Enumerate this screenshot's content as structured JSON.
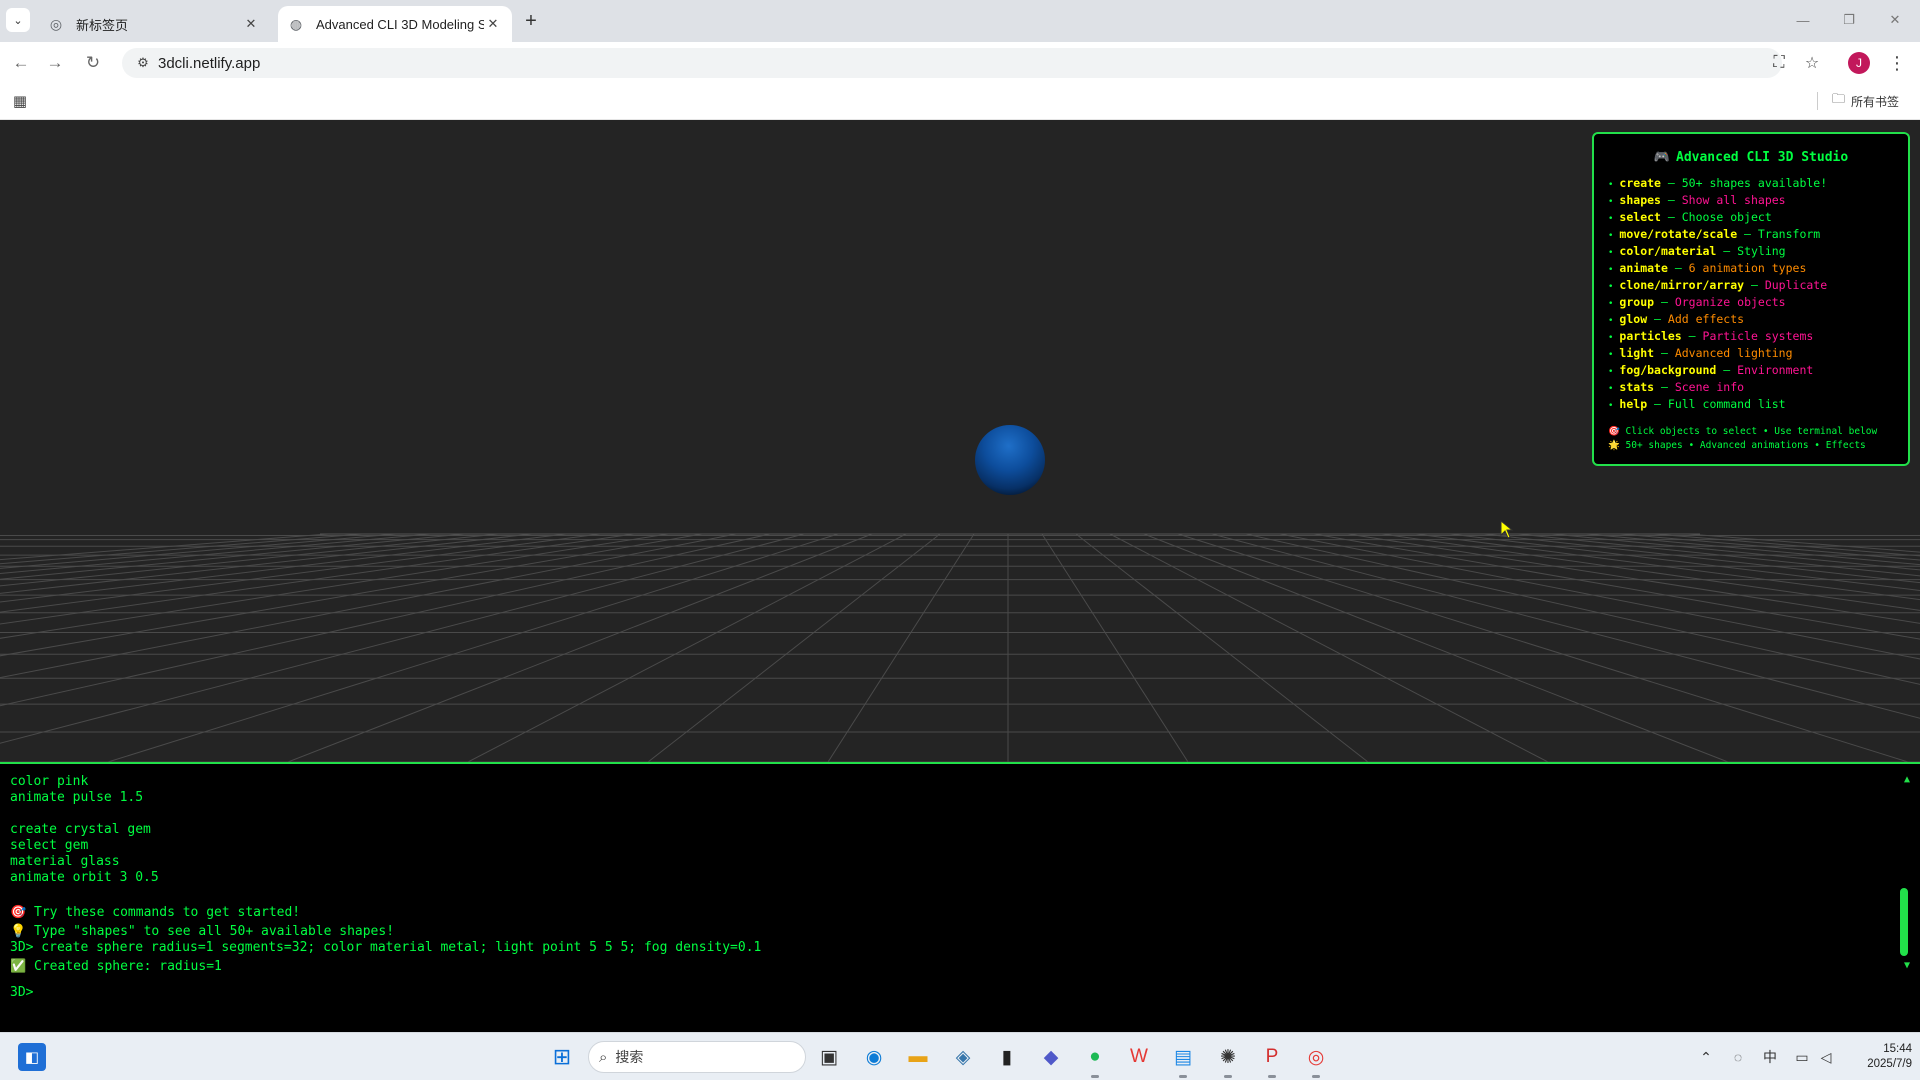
{
  "browser": {
    "tabs": [
      {
        "title": "新标签页",
        "active": false
      },
      {
        "title": "Advanced CLI 3D Modeling S",
        "active": true
      }
    ],
    "url": "3dcli.netlify.app",
    "bookmarks_all_label": "所有书签",
    "profile_initial": "J"
  },
  "help": {
    "title": "Advanced CLI 3D Studio",
    "items": [
      {
        "cmd": "create",
        "desc": "50+ shapes available!",
        "color": "#00ff41"
      },
      {
        "cmd": "shapes",
        "desc": "Show all shapes",
        "color": "#ff1493"
      },
      {
        "cmd": "select",
        "desc": "Choose object",
        "color": "#00ff41"
      },
      {
        "cmd": "move/rotate/scale",
        "desc": "Transform",
        "color": "#00ff41"
      },
      {
        "cmd": "color/material",
        "desc": "Styling",
        "color": "#00ff41"
      },
      {
        "cmd": "animate",
        "desc": "6 animation types",
        "color": "#ff8c00"
      },
      {
        "cmd": "clone/mirror/array",
        "desc": "Duplicate",
        "color": "#ff1493"
      },
      {
        "cmd": "group",
        "desc": "Organize objects",
        "color": "#ff1493"
      },
      {
        "cmd": "glow",
        "desc": "Add effects",
        "color": "#ff8c00"
      },
      {
        "cmd": "particles",
        "desc": "Particle systems",
        "color": "#ff1493"
      },
      {
        "cmd": "light",
        "desc": "Advanced lighting",
        "color": "#ff8c00"
      },
      {
        "cmd": "fog/background",
        "desc": "Environment",
        "color": "#ff1493"
      },
      {
        "cmd": "stats",
        "desc": "Scene info",
        "color": "#ff1493"
      },
      {
        "cmd": "help",
        "desc": "Full command list",
        "color": "#00ff41"
      }
    ],
    "footer1": "🎯 Click objects to select • Use terminal below",
    "footer2": "🌟 50+ shapes • Advanced animations • Effects"
  },
  "terminal": {
    "block1": [
      "color pink",
      "animate pulse 1.5"
    ],
    "block2": [
      "create crystal gem",
      "select gem",
      "material glass",
      "animate orbit 3 0.5"
    ],
    "block3": [
      "🎯 Try these commands to get started!",
      "💡 Type \"shapes\" to see all 50+ available shapes!",
      "3D> create sphere radius=1 segments=32; color material metal; light point 5 5 5; fog density=0.1",
      "✅ Created sphere: radius=1"
    ],
    "prompt": "3D>"
  },
  "taskbar": {
    "search_placeholder": "搜索",
    "ime": "中",
    "time": "15:44",
    "date": "2025/7/9"
  }
}
